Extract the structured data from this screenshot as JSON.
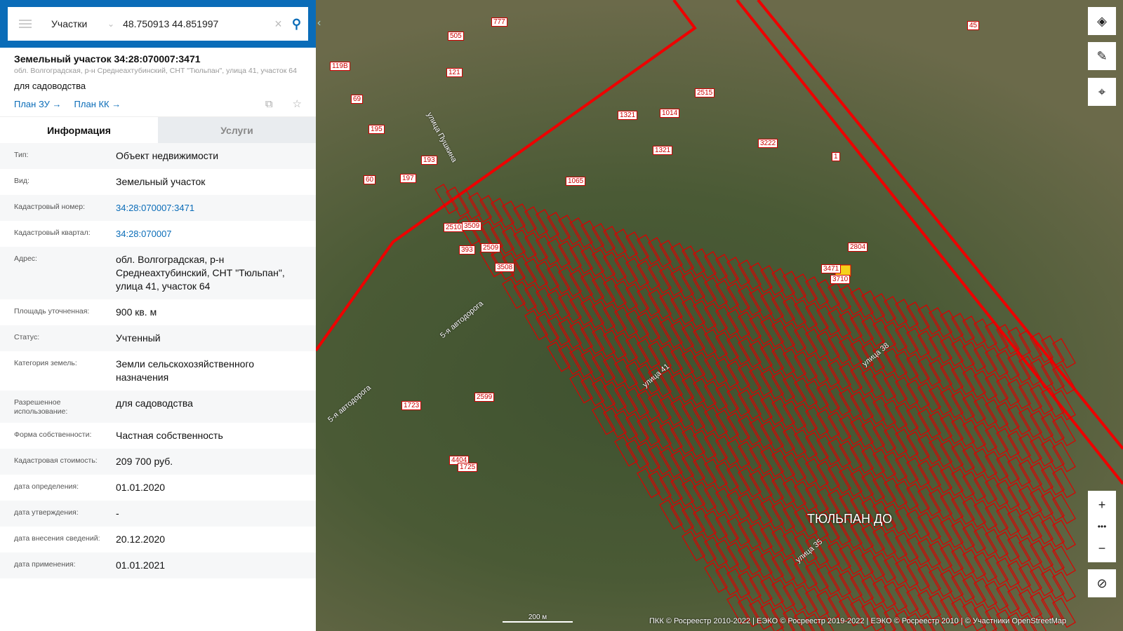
{
  "search": {
    "layer": "Участки",
    "query": "48.750913 44.851997"
  },
  "card": {
    "title": "Земельный участок 34:28:070007:3471",
    "address": "обл. Волгоградская, р-н Среднеахтубинский, СНТ \"Тюльпан\", улица 41, участок 64",
    "purpose": "для садоводства",
    "link1": "План ЗУ →",
    "link2": "План КК →"
  },
  "tabs": {
    "info": "Информация",
    "services": "Услуги"
  },
  "rows": [
    {
      "k": "Тип:",
      "v": "Объект недвижимости"
    },
    {
      "k": "Вид:",
      "v": "Земельный участок"
    },
    {
      "k": "Кадастровый номер:",
      "v": "34:28:070007:3471"
    },
    {
      "k": "Кадастровый квартал:",
      "v": "34:28:070007"
    },
    {
      "k": "Адрес:",
      "v": "обл. Волгоградская, р-н Среднеахтубинский, СНТ \"Тюльпан\", улица 41, участок 64"
    },
    {
      "k": "Площадь уточненная:",
      "v": "900 кв. м"
    },
    {
      "k": "Статус:",
      "v": "Учтенный"
    },
    {
      "k": "Категория земель:",
      "v": "Земли сельскохозяйственного назначения"
    },
    {
      "k": "Разрешенное использование:",
      "v": "для садоводства"
    },
    {
      "k": "Форма собственности:",
      "v": "Частная собственность"
    },
    {
      "k": "Кадастровая стоимость:",
      "v": "209 700 руб."
    },
    {
      "k": "дата определения:",
      "v": "01.01.2020"
    },
    {
      "k": "дата утверждения:",
      "v": "-"
    },
    {
      "k": "дата внесения сведений:",
      "v": "20.12.2020"
    },
    {
      "k": "дата применения:",
      "v": "01.01.2021"
    }
  ],
  "map": {
    "place": "ТЮЛЬПАН ДО",
    "streets": [
      "улица Пушкина",
      "5-я автодорога",
      "5-я автодорога",
      "улица 41",
      "улица 38",
      "улица 35"
    ],
    "parcels": [
      "505",
      "777",
      "45",
      "121",
      "119В",
      "69",
      "195",
      "1321",
      "1014",
      "2515",
      "1065",
      "1321",
      "3222",
      "60",
      "197",
      "193",
      "2510",
      "3509",
      "393",
      "2509",
      "3508",
      "1",
      "3471",
      "2804",
      "3710",
      "1723",
      "2599",
      "4404",
      "1725"
    ],
    "scale": "200 м",
    "attribution": "ПКК © Росреестр 2010-2022 | ЕЭКО © Росреестр 2019-2022 | ЕЭКО © Росреестр 2010 | © Участники OpenStreetMap"
  }
}
